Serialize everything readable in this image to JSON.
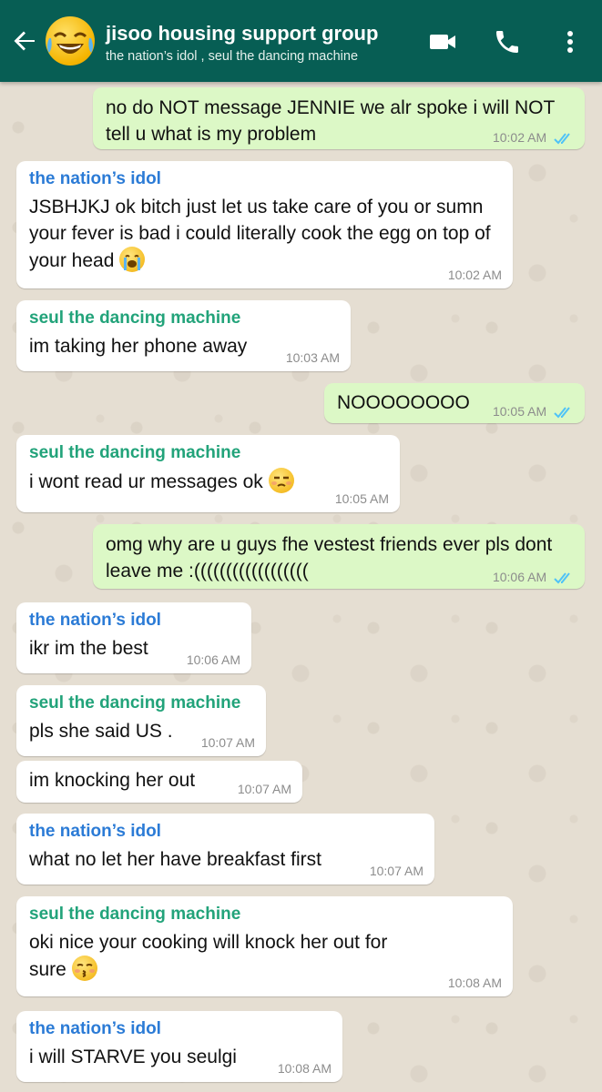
{
  "header": {
    "title": "jisoo housing support group",
    "members": "the nation’s idol , seul the dancing machine",
    "colors": {
      "bar": "#075e54",
      "icons": "#ffffff"
    },
    "icons": [
      "back-arrow-icon",
      "group-avatar",
      "video-call-icon",
      "voice-call-icon",
      "more-vert-icon"
    ]
  },
  "messages": [
    {
      "dir": "out",
      "text": "no do NOT message JENNIE we alr spoke i will NOT tell u what is my problem",
      "time": "10:02 AM",
      "read": true
    },
    {
      "dir": "in",
      "sender": "the nation’s idol",
      "text": "JSBHJKJ ok bitch just let us take care of you or sumn your fever is bad i could literally cook the egg on top of your head",
      "emoji": "loudly-crying-face-emoji",
      "time": "10:02 AM"
    },
    {
      "dir": "in",
      "sender": "seul the dancing machine",
      "text": "im taking her phone away",
      "time": "10:03 AM"
    },
    {
      "dir": "out",
      "text": "NOOOOOOOO",
      "time": "10:05 AM",
      "read": true
    },
    {
      "dir": "in",
      "sender": "seul the dancing machine",
      "text": "i wont read ur messages ok",
      "emoji": "unamused-face-emoji",
      "time": "10:05 AM"
    },
    {
      "dir": "out",
      "text": "omg why are u guys fhe vestest friends ever pls dont leave me :((((((((((((((((((",
      "time": "10:06 AM",
      "read": true
    },
    {
      "dir": "in",
      "sender": "the nation’s idol",
      "text": "ikr im the best",
      "time": "10:06 AM"
    },
    {
      "dir": "in",
      "sender": "seul the dancing machine",
      "text": "pls she said US .",
      "time": "10:07 AM"
    },
    {
      "dir": "in",
      "text": "im knocking her out",
      "time": "10:07 AM"
    },
    {
      "dir": "in",
      "sender": "the nation’s idol",
      "text": "what no let her have breakfast first",
      "time": "10:07 AM"
    },
    {
      "dir": "in",
      "sender": "seul the dancing machine",
      "text": "oki nice your cooking will knock her out for sure",
      "emoji": "kissing-face-emoji",
      "time": "10:08 AM"
    },
    {
      "dir": "in",
      "sender": "the nation’s idol",
      "text": "i will STARVE you seulgi",
      "time": "10:08 AM"
    }
  ],
  "colors": {
    "incoming_bubble": "#ffffff",
    "outgoing_bubble": "#dcf8c6",
    "sender_idol": "#2b7bd6",
    "sender_seul": "#22a37a",
    "read_ticks": "#4fc3f7"
  }
}
